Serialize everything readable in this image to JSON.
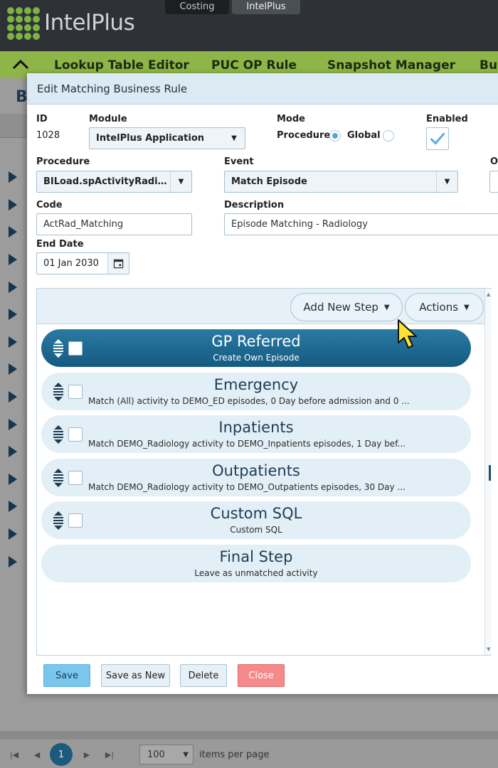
{
  "brand": {
    "name": "IntelPlus",
    "logo_color": "#7cb342"
  },
  "app_tabs": [
    {
      "label": "Costing"
    },
    {
      "label": "IntelPlus"
    }
  ],
  "nav": {
    "items": [
      "Lookup Table Editor",
      "PUC OP Rule",
      "Snapshot Manager",
      "Bus"
    ]
  },
  "background": {
    "title": "B",
    "pager": {
      "page": "1",
      "page_size": "100",
      "per_page_label": "items per page"
    }
  },
  "dialog": {
    "title": "Edit Matching Business Rule",
    "fields": {
      "id_label": "ID",
      "id_value": "1028",
      "module_label": "Module",
      "module_value": "IntelPlus Application",
      "mode_label": "Mode",
      "mode_procedure": "Procedure",
      "mode_global": "Global",
      "mode_selected": "Procedure",
      "enabled_label": "Enabled",
      "enabled": true,
      "procedure_label": "Procedure",
      "procedure_value": "BILoad.spActivityRadiol...",
      "event_label": "Event",
      "event_value": "Match Episode",
      "order_label": "O",
      "code_label": "Code",
      "code_value": "ActRad_Matching",
      "description_label": "Description",
      "description_value": "Episode Matching - Radiology",
      "enddate_label": "End Date",
      "enddate_value": "01 Jan 2030"
    },
    "toolbar": {
      "add_new_step": "Add New Step",
      "actions": "Actions"
    },
    "steps": [
      {
        "name": "GP Referred",
        "desc": "Create Own Episode"
      },
      {
        "name": "Emergency",
        "desc": "Match (All) activity to DEMO_ED episodes, 0 Day before admission and 0 ..."
      },
      {
        "name": "Inpatients",
        "desc": "Match DEMO_Radiology activity to DEMO_Inpatients episodes, 1 Day bef..."
      },
      {
        "name": "Outpatients",
        "desc": "Match DEMO_Radiology activity to DEMO_Outpatients episodes, 30 Day ..."
      },
      {
        "name": "Custom SQL",
        "desc": "Custom SQL"
      },
      {
        "name": "Final Step",
        "desc": "Leave as unmatched activity"
      }
    ],
    "buttons": {
      "save": "Save",
      "save_as_new": "Save as New",
      "delete": "Delete",
      "close": "Close"
    }
  },
  "colors": {
    "selected_step": "#1a6a93",
    "step_bg": "#e3eff7",
    "nav_green": "#8db548",
    "close_red": "#f48a8a",
    "save_blue": "#79c7ee"
  }
}
